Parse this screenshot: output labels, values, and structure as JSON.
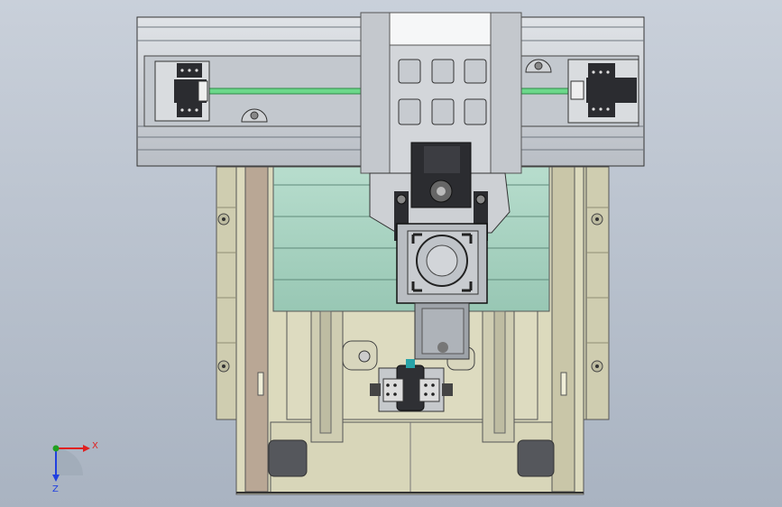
{
  "triad": {
    "x_label": "X",
    "y_label": "Y",
    "z_label": "Z"
  },
  "colors": {
    "background_top": "#c9d0da",
    "background_bottom": "#a9b3c1",
    "frame": "#d6d4b8",
    "frame_dark": "#a8a68c",
    "plate": "#cfd3d8",
    "plate_dark": "#9aa0a8",
    "green_panel": "#a9d3c2",
    "rail": "#6bd88a",
    "dark_part": "#2e2f33",
    "axis_x": "#e02020",
    "axis_y": "#20a020",
    "axis_z": "#2040e0"
  },
  "parts": [
    "base-frame-icon",
    "x-axis-rail-icon",
    "carriage-icon",
    "spindle-motor-icon",
    "y-axis-motor-icon",
    "coordinate-triad-icon"
  ]
}
